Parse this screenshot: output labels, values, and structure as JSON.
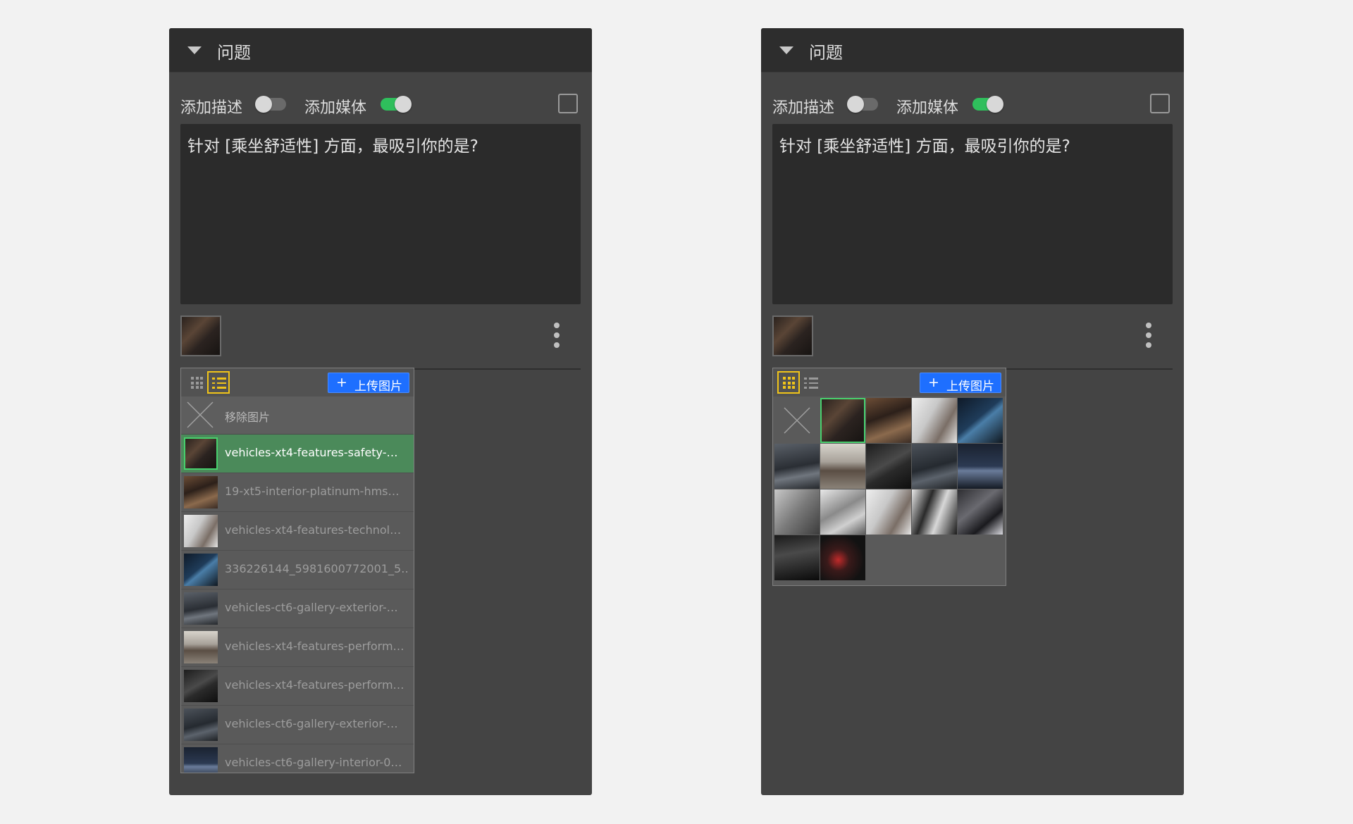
{
  "panels": [
    {
      "id": "left",
      "header": {
        "title": "问题"
      },
      "toggles": {
        "desc_label": "添加描述",
        "desc_on": false,
        "media_label": "添加媒体",
        "media_on": true
      },
      "question": "针对 [乘坐舒适性] 方面，最吸引你的是?",
      "picker": {
        "view": "list",
        "upload_label": "上传图片",
        "remove_label": "移除图片",
        "items": [
          {
            "text": "vehicles-xt4-features-safety-…",
            "selected": true
          },
          {
            "text": "19-xt5-interior-platinum-hms…",
            "selected": false
          },
          {
            "text": "vehicles-xt4-features-technol…",
            "selected": false
          },
          {
            "text": "336226144_5981600772001_5…",
            "selected": false
          },
          {
            "text": "vehicles-ct6-gallery-exterior-…",
            "selected": false
          },
          {
            "text": "vehicles-xt4-features-perform…",
            "selected": false
          },
          {
            "text": "vehicles-xt4-features-perform…",
            "selected": false
          },
          {
            "text": "vehicles-ct6-gallery-exterior-…",
            "selected": false
          },
          {
            "text": "vehicles-ct6-gallery-interior-0…",
            "selected": false
          }
        ]
      }
    },
    {
      "id": "right",
      "header": {
        "title": "问题"
      },
      "toggles": {
        "desc_label": "添加描述",
        "desc_on": false,
        "media_label": "添加媒体",
        "media_on": true
      },
      "question": "针对 [乘坐舒适性] 方面，最吸引你的是?",
      "picker": {
        "view": "grid",
        "upload_label": "上传图片",
        "grid_count": 15,
        "selected_index": 0
      }
    }
  ],
  "colors": {
    "accent_blue": "#1e6fff",
    "toggle_on": "#2fbf5c",
    "active_view": "#f0c419",
    "selected_row": "#4b8a5a"
  },
  "icons": [
    "chevron-down-icon",
    "kebab-menu-icon",
    "grid-view-icon",
    "list-view-icon",
    "plus-icon",
    "remove-x-icon"
  ]
}
